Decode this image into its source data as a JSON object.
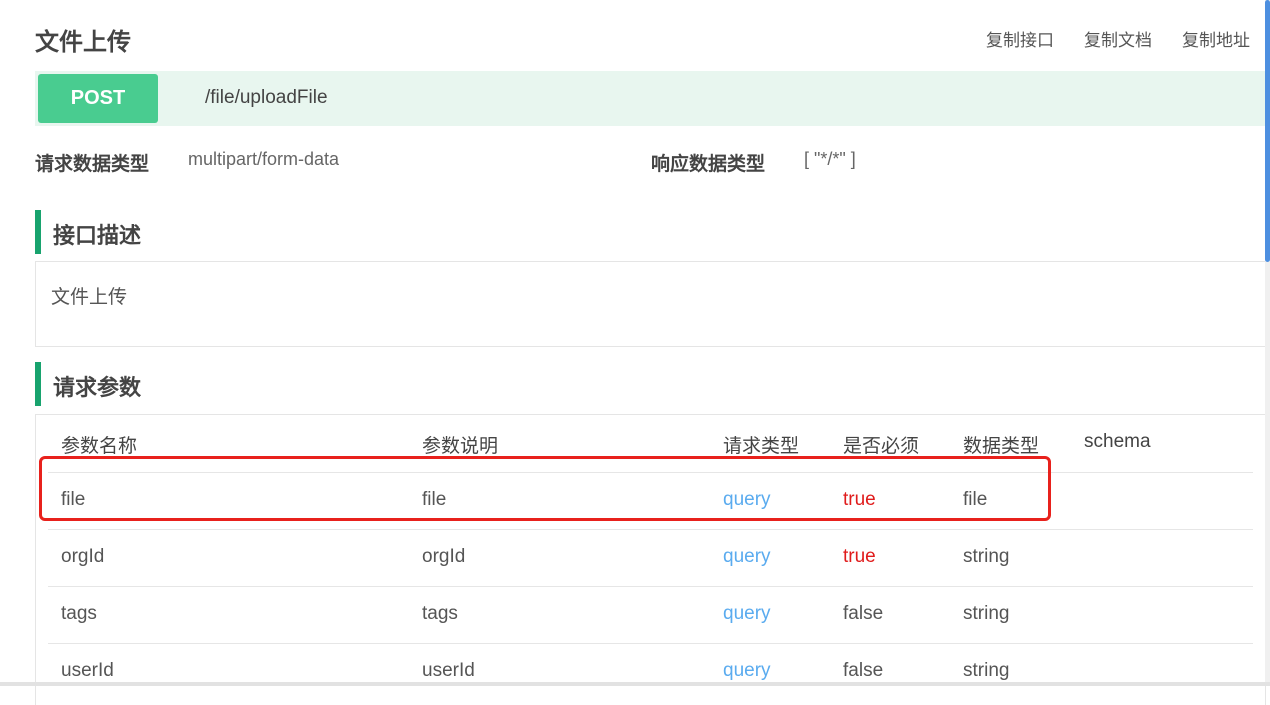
{
  "header": {
    "title": "文件上传",
    "actions": [
      "复制接口",
      "复制文档",
      "复制地址"
    ]
  },
  "endpoint": {
    "method": "POST",
    "path": "/file/uploadFile"
  },
  "meta": {
    "request_type_label": "请求数据类型",
    "request_type_value": "multipart/form-data",
    "response_type_label": "响应数据类型",
    "response_type_value": "[ \"*/*\" ]"
  },
  "description_section": {
    "heading": "接口描述",
    "text": "文件上传"
  },
  "params_section": {
    "heading": "请求参数",
    "columns": [
      "参数名称",
      "参数说明",
      "请求类型",
      "是否必须",
      "数据类型",
      "schema"
    ],
    "rows": [
      {
        "name": "file",
        "desc": "file",
        "in": "query",
        "required": "true",
        "type": "file"
      },
      {
        "name": "orgId",
        "desc": "orgId",
        "in": "query",
        "required": "true",
        "type": "string"
      },
      {
        "name": "tags",
        "desc": "tags",
        "in": "query",
        "required": "false",
        "type": "string"
      },
      {
        "name": "userId",
        "desc": "userId",
        "in": "query",
        "required": "false",
        "type": "string"
      }
    ]
  },
  "colors": {
    "post_badge": "#49cc90",
    "endpoint_bg": "#e8f6ef",
    "section_accent": "#18a36e",
    "query_text": "#5aabef",
    "required_true": "#e01b1b",
    "highlight_border": "#e8211c",
    "scrollbar": "#4d8fe0"
  }
}
